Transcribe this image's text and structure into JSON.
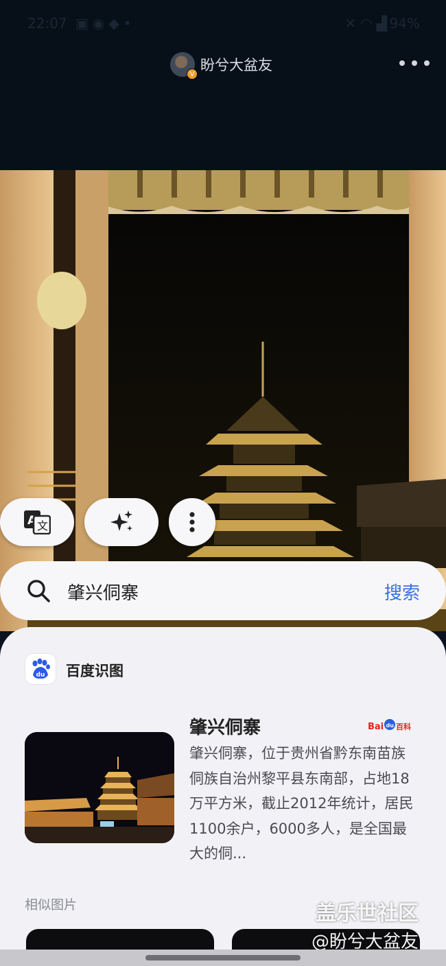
{
  "status_bar": {
    "time": "22:07",
    "left_icons": [
      "gallery-icon",
      "location-icon",
      "bag-icon",
      "dot-icon"
    ],
    "right_icons": [
      "mute-icon",
      "wifi-icon",
      "signal-icon"
    ],
    "battery": "94%"
  },
  "header": {
    "username": "盼兮大盆友",
    "avatar_badge": "V"
  },
  "actions": {
    "translate_icon": "translate-icon",
    "ai_icon": "sparkle-icon",
    "more_icon": "more-vertical-icon"
  },
  "search": {
    "query": "肇兴侗寨",
    "button_label": "搜索"
  },
  "result": {
    "provider_name": "百度识图",
    "title": "肇兴侗寨",
    "source_logo_text_1": "Bai",
    "source_logo_text_2": "du",
    "source_logo_text_3": "百科",
    "description": "肇兴侗寨，位于贵州省黔东南苗族侗族自治州黎平县东南部，占地18万平方米，截止2012年统计，居民1100余户，6000多人，是全国最大的侗...",
    "similar_label": "相似图片"
  },
  "watermark": {
    "community": "盖乐世社区",
    "user": "@盼兮大盆友"
  },
  "colors": {
    "accent": "#3a6fe0",
    "sheet_bg": "#f2f2f6",
    "top_bg": "#071019"
  }
}
